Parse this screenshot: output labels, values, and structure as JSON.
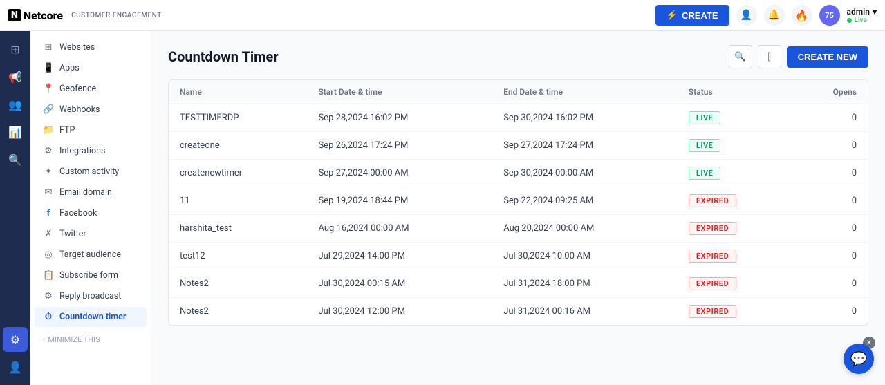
{
  "topbar": {
    "logo_n": "N",
    "logo_text": "Netcore",
    "customer_eng": "CUSTOMER ENGAGEMENT",
    "create_label": "CREATE",
    "admin_name": "admin",
    "admin_chevron": "▾",
    "live_label": "Live",
    "score": "75"
  },
  "sidebar": {
    "items": [
      {
        "id": "websites",
        "label": "Websites",
        "icon": "⊞"
      },
      {
        "id": "apps",
        "label": "Apps",
        "icon": "📱"
      },
      {
        "id": "geofence",
        "label": "Geofence",
        "icon": "📍"
      },
      {
        "id": "webhooks",
        "label": "Webhooks",
        "icon": "🔗"
      },
      {
        "id": "ftp",
        "label": "FTP",
        "icon": "📁"
      },
      {
        "id": "integrations",
        "label": "Integrations",
        "icon": "⚙"
      },
      {
        "id": "custom-activity",
        "label": "Custom activity",
        "icon": "✦"
      },
      {
        "id": "email-domain",
        "label": "Email domain",
        "icon": "✉"
      },
      {
        "id": "facebook",
        "label": "Facebook",
        "icon": "f"
      },
      {
        "id": "twitter",
        "label": "Twitter",
        "icon": "𝕏"
      },
      {
        "id": "target-audience",
        "label": "Target audience",
        "icon": "◎"
      },
      {
        "id": "subscribe-form",
        "label": "Subscribe form",
        "icon": "📋"
      },
      {
        "id": "reply-broadcast",
        "label": "Reply broadcast",
        "icon": "⚙"
      },
      {
        "id": "countdown-timer",
        "label": "Countdown timer",
        "icon": "⏱",
        "active": true
      }
    ],
    "minimize_label": "MINIMIZE THIS"
  },
  "page": {
    "title": "Countdown Timer",
    "create_new_label": "CREATE NEW",
    "search_tooltip": "Search",
    "filter_tooltip": "Filter"
  },
  "table": {
    "columns": [
      {
        "id": "name",
        "label": "Name"
      },
      {
        "id": "start_date",
        "label": "Start Date & time"
      },
      {
        "id": "end_date",
        "label": "End Date & time"
      },
      {
        "id": "status",
        "label": "Status"
      },
      {
        "id": "opens",
        "label": "Opens"
      }
    ],
    "rows": [
      {
        "name": "TESTTIMERDP",
        "start": "Sep 28,2024 16:02 PM",
        "end": "Sep 30,2024 16:02 PM",
        "status": "LIVE",
        "opens": "0"
      },
      {
        "name": "createone",
        "start": "Sep 26,2024 17:24 PM",
        "end": "Sep 27,2024 17:24 PM",
        "status": "LIVE",
        "opens": "0"
      },
      {
        "name": "createnewtimer",
        "start": "Sep 27,2024 00:00 AM",
        "end": "Sep 30,2024 00:00 AM",
        "status": "LIVE",
        "opens": "0"
      },
      {
        "name": "11",
        "start": "Sep 19,2024 18:44 PM",
        "end": "Sep 22,2024 09:25 AM",
        "status": "EXPIRED",
        "opens": "0"
      },
      {
        "name": "harshita_test",
        "start": "Aug 16,2024 00:00 AM",
        "end": "Aug 20,2024 00:00 AM",
        "status": "EXPIRED",
        "opens": "0"
      },
      {
        "name": "test12",
        "start": "Jul 29,2024 14:00 PM",
        "end": "Jul 30,2024 10:00 AM",
        "status": "EXPIRED",
        "opens": "0"
      },
      {
        "name": "Notes2",
        "start": "Jul 30,2024 00:15 AM",
        "end": "Jul 31,2024 18:00 PM",
        "status": "EXPIRED",
        "opens": "0"
      },
      {
        "name": "Notes2",
        "start": "Jul 30,2024 12:00 PM",
        "end": "Jul 31,2024 00:16 AM",
        "status": "EXPIRED",
        "opens": "0"
      }
    ]
  },
  "icons": {
    "search": "🔍",
    "filter": "⫿",
    "chat": "💬",
    "close": "✕",
    "lightning": "⚡",
    "bell": "🔔",
    "user": "👤",
    "flame": "🔥"
  }
}
